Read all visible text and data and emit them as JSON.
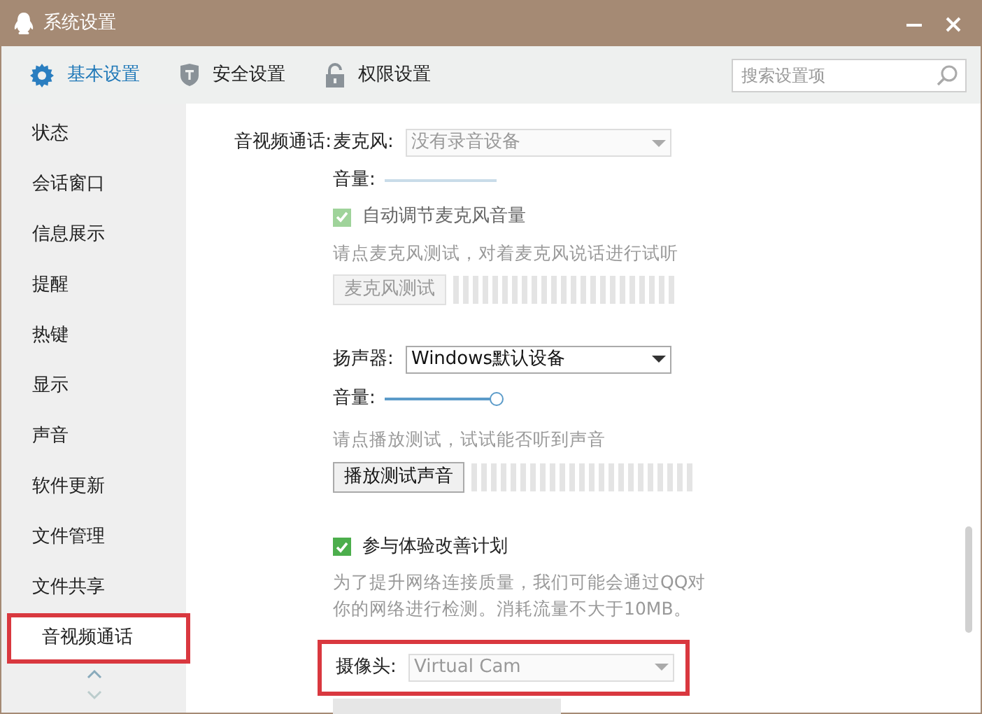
{
  "window": {
    "title": "系统设置"
  },
  "tabs": [
    {
      "label": "基本设置",
      "selected": true
    },
    {
      "label": "安全设置",
      "selected": false
    },
    {
      "label": "权限设置",
      "selected": false
    }
  ],
  "search": {
    "placeholder": "搜索设置项"
  },
  "sidebar": {
    "items": [
      {
        "label": "状态",
        "selected": false,
        "annotated": false
      },
      {
        "label": "会话窗口",
        "selected": false,
        "annotated": false
      },
      {
        "label": "信息展示",
        "selected": false,
        "annotated": false
      },
      {
        "label": "提醒",
        "selected": false,
        "annotated": false
      },
      {
        "label": "热键",
        "selected": false,
        "annotated": false
      },
      {
        "label": "显示",
        "selected": false,
        "annotated": false
      },
      {
        "label": "声音",
        "selected": false,
        "annotated": false
      },
      {
        "label": "软件更新",
        "selected": false,
        "annotated": false
      },
      {
        "label": "文件管理",
        "selected": false,
        "annotated": false
      },
      {
        "label": "文件共享",
        "selected": false,
        "annotated": false
      },
      {
        "label": "音视频通话",
        "selected": true,
        "annotated": true
      }
    ]
  },
  "section": {
    "title": "音视频通话:",
    "microphone": {
      "label": "麦克风:",
      "value": "没有录音设备",
      "disabled": true,
      "volume_label": "音量:",
      "level": 1,
      "auto_adjust": {
        "label": "自动调节麦克风音量",
        "checked": true,
        "disabled": true
      },
      "hint": "请点麦克风测试，对着麦克风说话进行试听",
      "test_button": "麦克风测试"
    },
    "speaker": {
      "label": "扬声器:",
      "value": "Windows默认设备",
      "disabled": false,
      "volume_label": "音量:",
      "level": 1,
      "hint": "请点播放测试，试试能否听到声音",
      "test_button": "播放测试声音"
    },
    "experience": {
      "label": "参与体验改善计划",
      "checked": true,
      "disabled": false,
      "description": "为了提升网络连接质量，我们可能会通过QQ对你的网络进行检测。消耗流量不大于10MB。"
    },
    "camera": {
      "label": "摄像头:",
      "value": "Virtual Cam",
      "disabled": true,
      "annotated": true
    }
  }
}
